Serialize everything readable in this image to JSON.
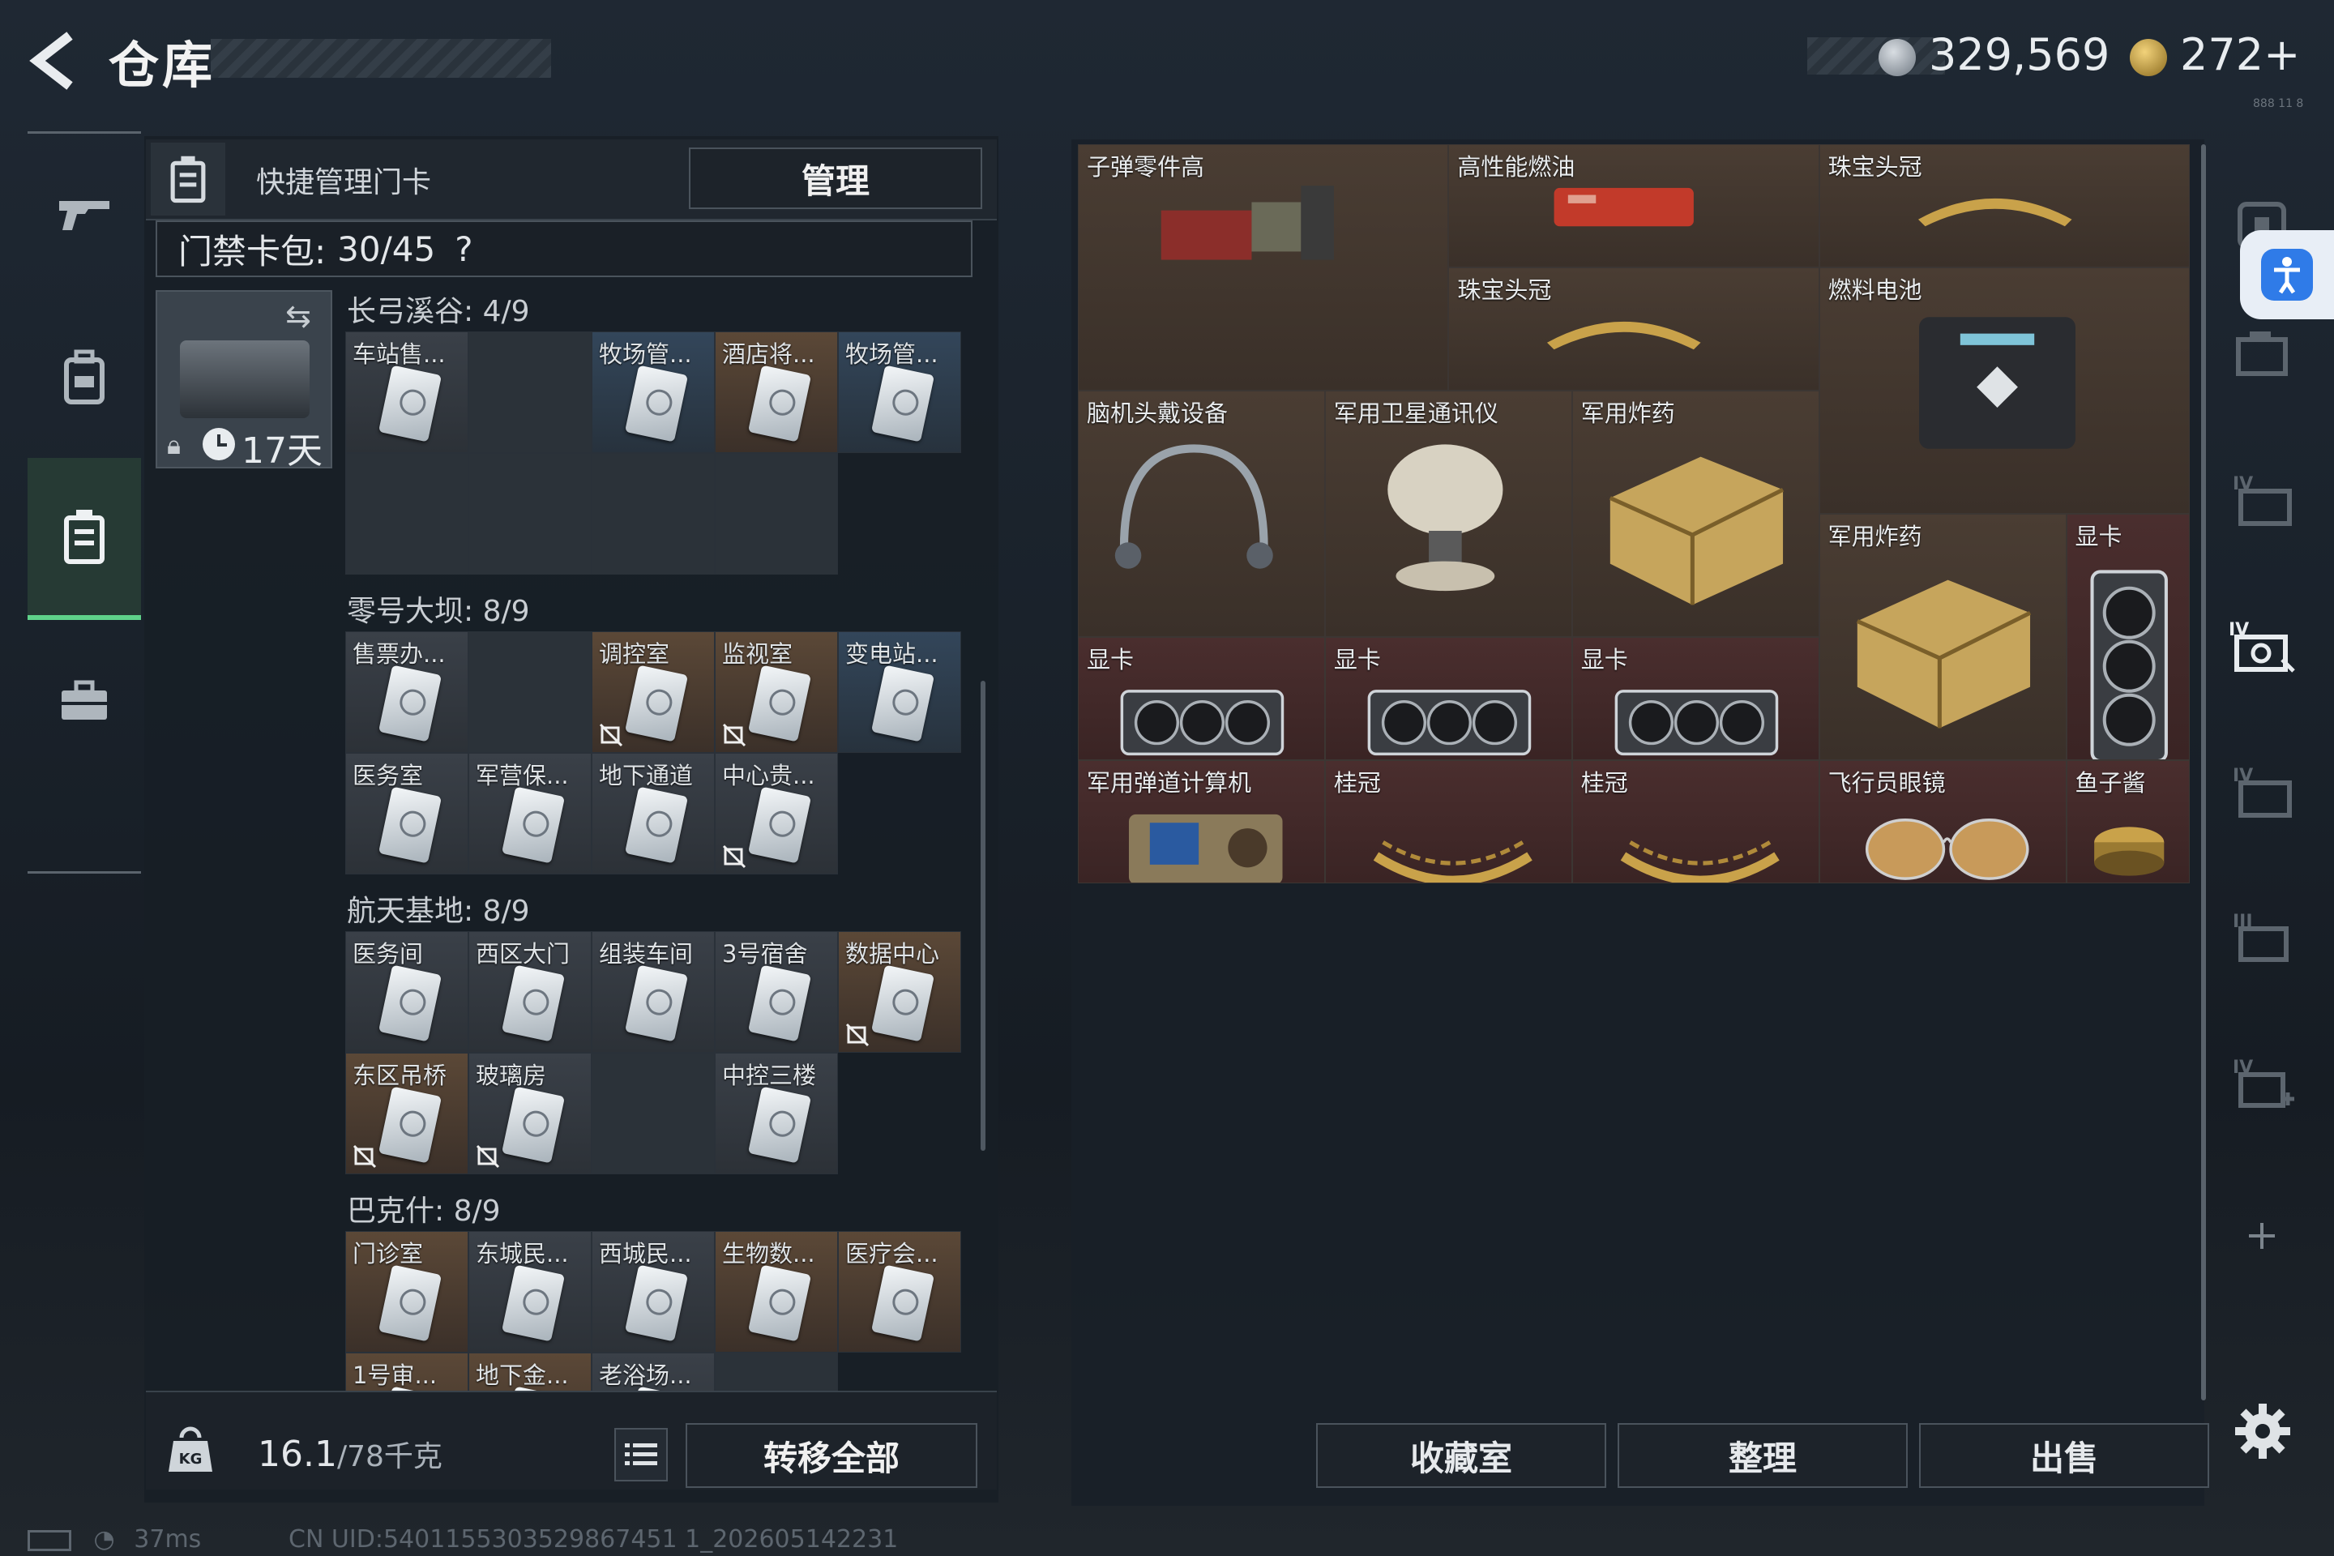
{
  "header": {
    "title": "仓库",
    "currency1": "329,569",
    "currency2": "272+",
    "tiny_text": "888 11 8"
  },
  "nav": {
    "items": [
      "weapon-icon",
      "backpack-icon",
      "keycard-case-icon",
      "toolbox-icon"
    ],
    "active_index": 2
  },
  "keycard_panel": {
    "title": "快捷管理门卡",
    "manage_label": "管理",
    "capacity_label": "门禁卡包:",
    "capacity_value": "30/45",
    "help": "?",
    "pack_days": "17天",
    "sections": [
      {
        "title": "长弓溪谷: 4/9",
        "cells": [
          {
            "label": "车站售...",
            "bg": "gray",
            "card": true
          },
          {
            "label": "",
            "bg": "empty",
            "card": false
          },
          {
            "label": "牧场管...",
            "bg": "blue",
            "card": true
          },
          {
            "label": "酒店将...",
            "bg": "brown",
            "card": true
          },
          {
            "label": "牧场管...",
            "bg": "blue",
            "card": true
          },
          {
            "label": "",
            "bg": "empty",
            "card": false
          },
          {
            "label": "",
            "bg": "empty",
            "card": false
          },
          {
            "label": "",
            "bg": "empty",
            "card": false
          },
          {
            "label": "",
            "bg": "empty",
            "card": false
          }
        ]
      },
      {
        "title": "零号大坝: 8/9",
        "cells": [
          {
            "label": "售票办...",
            "bg": "gray",
            "card": true
          },
          {
            "label": "",
            "bg": "empty",
            "card": false
          },
          {
            "label": "调控室",
            "bg": "brown",
            "card": true,
            "noicon": true
          },
          {
            "label": "监视室",
            "bg": "brown",
            "card": true,
            "noicon": true
          },
          {
            "label": "变电站...",
            "bg": "blue",
            "card": true
          },
          {
            "label": "医务室",
            "bg": "gray",
            "card": true
          },
          {
            "label": "军营保...",
            "bg": "gray",
            "card": true
          },
          {
            "label": "地下通道",
            "bg": "gray",
            "card": true
          },
          {
            "label": "中心贵...",
            "bg": "gray",
            "card": true,
            "noicon": true
          }
        ]
      },
      {
        "title": "航天基地: 8/9",
        "cells": [
          {
            "label": "医务间",
            "bg": "gray",
            "card": true
          },
          {
            "label": "西区大门",
            "bg": "gray",
            "card": true
          },
          {
            "label": "组装车间",
            "bg": "gray",
            "card": true
          },
          {
            "label": "3号宿舍",
            "bg": "gray",
            "card": true
          },
          {
            "label": "数据中心",
            "bg": "brown",
            "card": true,
            "noicon": true
          },
          {
            "label": "东区吊桥",
            "bg": "brown",
            "card": true,
            "noicon": true
          },
          {
            "label": "玻璃房",
            "bg": "gray",
            "card": true,
            "noicon": true
          },
          {
            "label": "",
            "bg": "empty",
            "card": false
          },
          {
            "label": "中控三楼",
            "bg": "gray",
            "card": true
          }
        ]
      },
      {
        "title": "巴克什: 8/9",
        "cells": [
          {
            "label": "门诊室",
            "bg": "brown",
            "card": true
          },
          {
            "label": "东城民...",
            "bg": "gray",
            "card": true
          },
          {
            "label": "西城民...",
            "bg": "gray",
            "card": true
          },
          {
            "label": "生物数...",
            "bg": "brown",
            "card": true
          },
          {
            "label": "医疗会...",
            "bg": "brown",
            "card": true
          },
          {
            "label": "1号审...",
            "bg": "brown",
            "card": true
          },
          {
            "label": "地下金...",
            "bg": "brown",
            "card": true
          },
          {
            "label": "老浴场...",
            "bg": "gray",
            "card": true
          },
          {
            "label": "",
            "bg": "empty",
            "card": false
          }
        ]
      }
    ],
    "weight_value": "16.1",
    "weight_max": "/78千克",
    "transfer_label": "转移全部"
  },
  "inventory": {
    "items": [
      {
        "label": "子弹零件高",
        "color": "brown",
        "pic": "ammo-parts"
      },
      {
        "label": "高性能燃油",
        "color": "brown",
        "pic": "fuel-case"
      },
      {
        "label": "珠宝头冠",
        "color": "brown",
        "pic": "tiara"
      },
      {
        "label": "珠宝头冠",
        "color": "brown",
        "pic": "tiara"
      },
      {
        "label": "燃料电池",
        "color": "brown",
        "pic": "fuel-cell"
      },
      {
        "label": "脑机头戴设备",
        "color": "brown",
        "pic": "headset"
      },
      {
        "label": "军用卫星通讯仪",
        "color": "brown",
        "pic": "satellite"
      },
      {
        "label": "军用炸药",
        "color": "brown",
        "pic": "explosive"
      },
      {
        "label": "军用炸药",
        "color": "brown",
        "pic": "explosive"
      },
      {
        "label": "显卡",
        "color": "red",
        "pic": "gpu-vertical"
      },
      {
        "label": "显卡",
        "color": "red",
        "pic": "gpu"
      },
      {
        "label": "显卡",
        "color": "red",
        "pic": "gpu"
      },
      {
        "label": "显卡",
        "color": "red",
        "pic": "gpu"
      },
      {
        "label": "军用弹道计算机",
        "color": "red",
        "pic": "ballistic-computer"
      },
      {
        "label": "桂冠",
        "color": "red",
        "pic": "laurel"
      },
      {
        "label": "桂冠",
        "color": "red",
        "pic": "laurel"
      },
      {
        "label": "飞行员眼镜",
        "color": "red",
        "pic": "sunglasses"
      },
      {
        "label": "鱼子酱",
        "color": "red",
        "pic": "caviar"
      }
    ],
    "collect_label": "收藏室",
    "sort_label": "整理",
    "sell_label": "出售"
  },
  "status": {
    "ping": "37ms",
    "uid": "CN UID:5401155303529867451 1_202605142231"
  }
}
